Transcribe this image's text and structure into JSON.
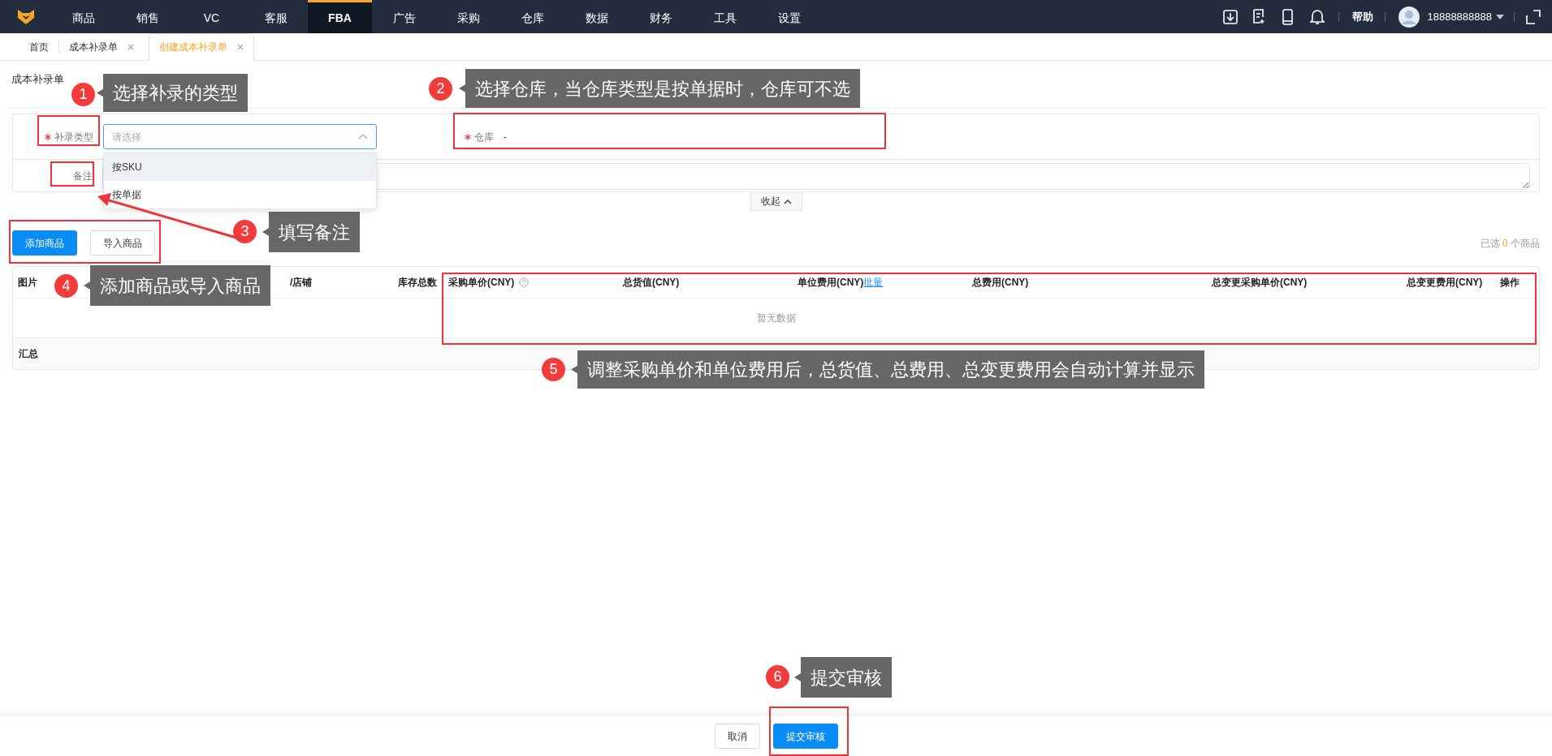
{
  "top_nav": {
    "items": [
      {
        "label": "商品",
        "selected": false
      },
      {
        "label": "销售",
        "selected": false
      },
      {
        "label": "VC",
        "selected": false
      },
      {
        "label": "客服",
        "selected": false
      },
      {
        "label": "FBA",
        "selected": true
      },
      {
        "label": "广告",
        "selected": false
      },
      {
        "label": "采购",
        "selected": false
      },
      {
        "label": "仓库",
        "selected": false
      },
      {
        "label": "数据",
        "selected": false
      },
      {
        "label": "财务",
        "selected": false
      },
      {
        "label": "工具",
        "selected": false
      },
      {
        "label": "设置",
        "selected": false
      }
    ],
    "help": "帮助",
    "user": "18888888888"
  },
  "page_tabs": [
    {
      "label": "首页",
      "closable": false,
      "selected": false
    },
    {
      "label": "成本补录单",
      "closable": true,
      "selected": false
    },
    {
      "label": "创建成本补录单",
      "closable": true,
      "selected": true
    }
  ],
  "page_title": "成本补录单",
  "form": {
    "fields": [
      {
        "kind": "select",
        "label": "补录类型",
        "required": true,
        "placeholder": "请选择"
      },
      {
        "kind": "text",
        "label": "仓库",
        "required": true,
        "value": "-"
      },
      {
        "kind": "textarea",
        "label": "备注",
        "required": false
      }
    ],
    "dropdown_options": [
      {
        "label": "按SKU",
        "hovered": true
      },
      {
        "label": "按单据",
        "hovered": false
      }
    ],
    "collapse_button": "收起"
  },
  "actions": [
    {
      "label": "添加商品",
      "kind": "primary"
    },
    {
      "label": "导入商品",
      "kind": "default"
    }
  ],
  "selection": {
    "prefix": "已选",
    "count": "0",
    "suffix": "个商品"
  },
  "table": {
    "columns": [
      {
        "label": "图片"
      },
      {
        "label": "/店铺"
      },
      {
        "label": "库存总数"
      },
      {
        "label": "采购单价(CNY)",
        "help": true
      },
      {
        "label": "总货值(CNY)"
      },
      {
        "label": "单位费用(CNY)",
        "link": "批量"
      },
      {
        "label": "总费用(CNY)"
      },
      {
        "label": "总变更采购单价(CNY)"
      },
      {
        "label": "总变更费用(CNY)"
      },
      {
        "label": "操作"
      }
    ],
    "empty_text": "暂无数据",
    "summary_label": "汇总"
  },
  "footer_buttons": [
    {
      "label": "取消",
      "kind": "default"
    },
    {
      "label": "提交审核",
      "kind": "primary"
    }
  ],
  "annotations": [
    {
      "number": "1",
      "text": "选择补录的类型"
    },
    {
      "number": "2",
      "text": "选择仓库，当仓库类型是按单据时，仓库可不选"
    },
    {
      "number": "3",
      "text": "填写备注"
    },
    {
      "number": "4",
      "text": "添加商品或导入商品"
    },
    {
      "number": "5",
      "text": "调整采购单价和单位费用后，总货值、总费用、总变更费用会自动计算并显示"
    },
    {
      "number": "6",
      "text": "提交审核"
    }
  ]
}
